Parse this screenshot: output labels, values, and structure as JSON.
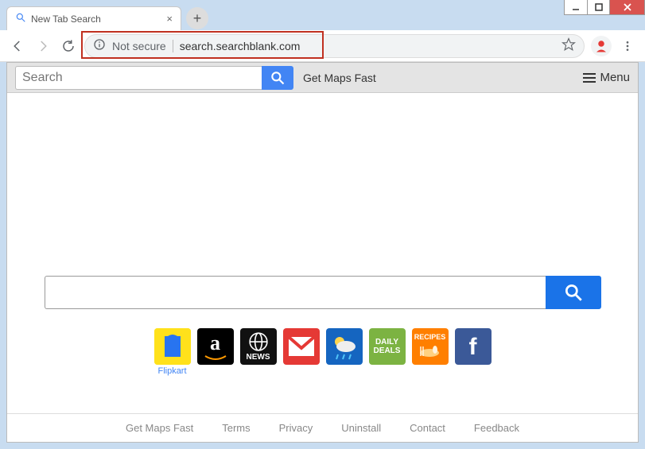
{
  "window": {
    "tab_title": "New Tab Search"
  },
  "toolbar": {
    "security_label": "Not secure",
    "url": "search.searchblank.com"
  },
  "page": {
    "top_search_placeholder": "Search",
    "maps_link": "Get Maps Fast",
    "menu_label": "Menu",
    "main_search_value": "",
    "tiles": [
      {
        "name": "flipkart",
        "label": "Flipkart",
        "text": "",
        "class": "t-flipkart"
      },
      {
        "name": "amazon",
        "label": "",
        "text": "a",
        "class": "t-amazon"
      },
      {
        "name": "news",
        "label": "",
        "text": "NEWS",
        "class": "t-news"
      },
      {
        "name": "gmail",
        "label": "",
        "text": "",
        "class": "t-gmail"
      },
      {
        "name": "weather",
        "label": "",
        "text": "",
        "class": "t-weather"
      },
      {
        "name": "daily-deals",
        "label": "",
        "text": "DAILY DEALS",
        "class": "t-deals"
      },
      {
        "name": "recipes",
        "label": "",
        "text": "RECIPES",
        "class": "t-recipes"
      },
      {
        "name": "facebook",
        "label": "",
        "text": "f",
        "class": "t-fb"
      }
    ],
    "footer": {
      "maps": "Get Maps Fast",
      "terms": "Terms",
      "privacy": "Privacy",
      "uninstall": "Uninstall",
      "contact": "Contact",
      "feedback": "Feedback"
    }
  }
}
